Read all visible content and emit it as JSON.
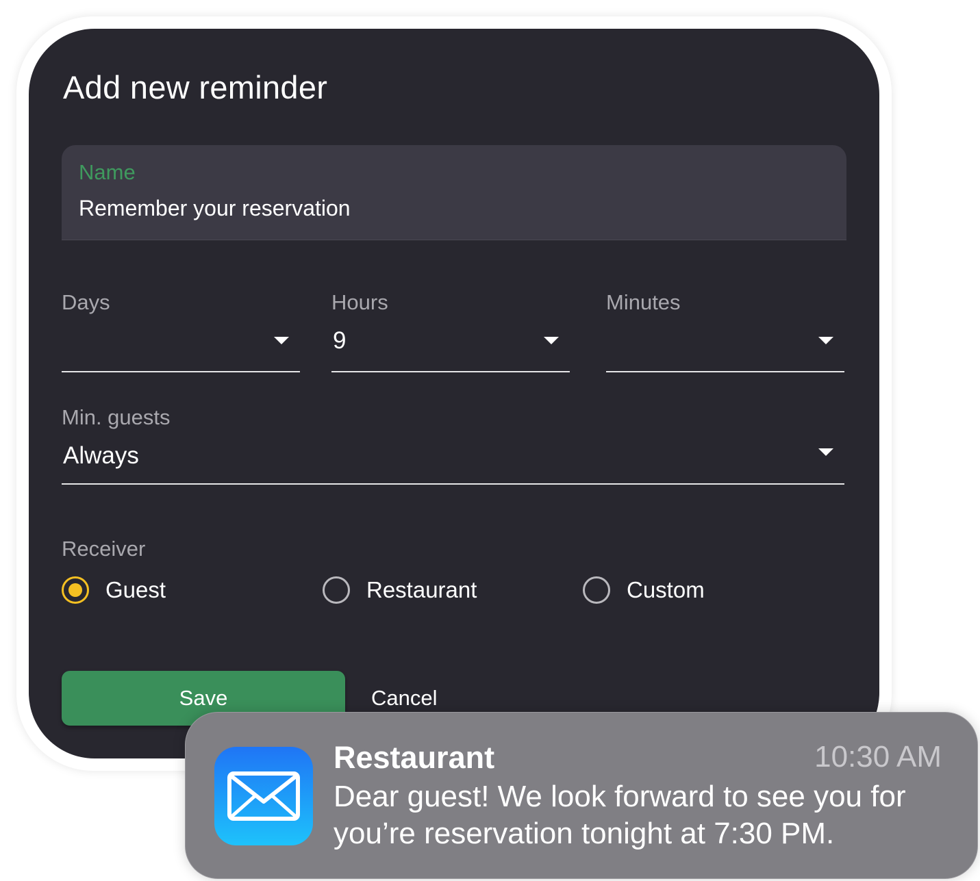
{
  "dialog": {
    "title": "Add new reminder",
    "name_field": {
      "label": "Name",
      "value": "Remember your reservation"
    },
    "days": {
      "label": "Days",
      "value": ""
    },
    "hours": {
      "label": "Hours",
      "value": "9"
    },
    "minutes": {
      "label": "Minutes",
      "value": ""
    },
    "min_guests": {
      "label": "Min. guests",
      "value": "Always"
    },
    "receiver": {
      "label": "Receiver",
      "options": [
        "Guest",
        "Restaurant",
        "Custom"
      ],
      "selected": "Guest"
    },
    "save_label": "Save",
    "cancel_label": "Cancel"
  },
  "notification": {
    "app": "Restaurant",
    "time": "10:30 AM",
    "message": "Dear guest! We look forward to see you for you’re reservation tonight at 7:30 PM.",
    "icon": "mail-icon"
  },
  "colors": {
    "dialog_bg": "#28272f",
    "accent_green": "#3a8f5a",
    "radio_selected": "#f5c022",
    "notification_bg": "#807f84"
  }
}
